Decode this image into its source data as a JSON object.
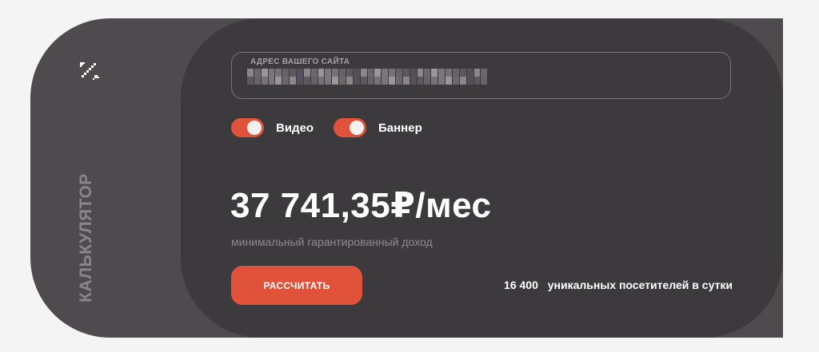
{
  "sidebar": {
    "icon": "percent-icon",
    "label": "КАЛЬКУЛЯТОР"
  },
  "site_field": {
    "label": "АДРЕС ВАШЕГО САЙТА",
    "value": "",
    "placeholder": "",
    "value_obscured": true
  },
  "toggles": [
    {
      "label": "Видео",
      "on": true
    },
    {
      "label": "Баннер",
      "on": true
    }
  ],
  "result": {
    "amount": "37 741,35₽/мес",
    "caption": "минимальный гарантированный доход"
  },
  "calculate_button": {
    "label": "РАССЧИТАТЬ"
  },
  "visitors": {
    "count": "16 400",
    "text": "уникальных посетителей в сутки"
  },
  "colors": {
    "accent": "#e0533a",
    "panel_dark": "#3d3a3d",
    "panel_side": "#4f4a4e",
    "background": "#f4f4f4"
  }
}
